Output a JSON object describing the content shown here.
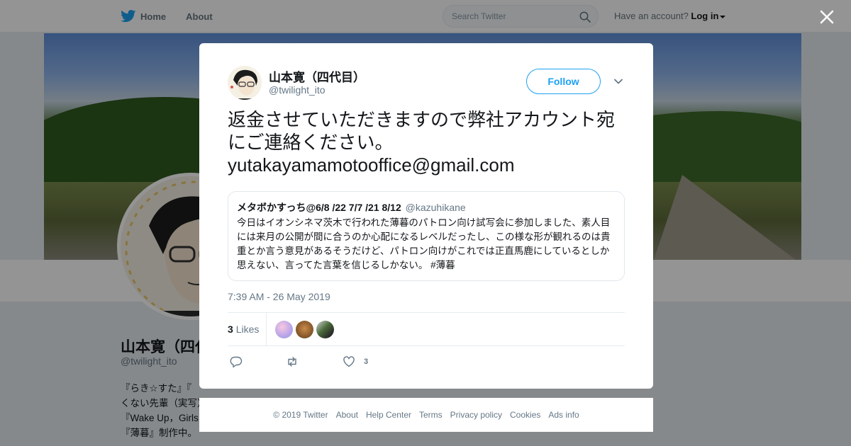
{
  "nav": {
    "home_label": "Home",
    "about_label": "About",
    "search_placeholder": "Search Twitter",
    "account_prompt": "Have an account?",
    "login_label": "Log in"
  },
  "profile": {
    "name": "山本寛（四代目）",
    "handle": "@twilight_ito",
    "bio_lines": [
      "『らき☆すた』『",
      "くない先輩（実写）『フラクタル",
      "『Wake Up，Girls",
      "『薄暮』制作中。"
    ]
  },
  "tweet": {
    "author_name": "山本寛（四代目）",
    "author_handle": "@twilight_ito",
    "follow_label": "Follow",
    "text": "返金させていただきますので弊社アカウント宛にご連絡ください。\nyutakayamamotooffice@gmail.com",
    "quoted": {
      "author_name": "メタボかすっち@6/8 /22 7/7 /21 8/12",
      "author_handle": "@kazuhikane",
      "text": "今日はイオンシネマ茨木で行われた薄暮のパトロン向け試写会に参加しました、素人目には来月の公開が間に合うのか心配になるレベルだったし、この様な形が観れるのは貴重とか言う意見があるそうだけど、パトロン向けがこれでは正直馬鹿にしているとしか思えない、言ってた言葉を信じるしかない。 #薄暮"
    },
    "timestamp": "7:39 AM - 26 May 2019",
    "likes_count": "3",
    "likes_label": "Likes",
    "like_action_count": "3"
  },
  "footer": {
    "links": [
      "© 2019 Twitter",
      "About",
      "Help Center",
      "Terms",
      "Privacy policy",
      "Cookies",
      "Ads info"
    ]
  },
  "colors": {
    "accent": "#1da1f2",
    "secondary_text": "#657786"
  },
  "icons": [
    "twitter-bird-icon",
    "search-icon",
    "close-icon",
    "chevron-down-icon",
    "reply-icon",
    "retweet-icon",
    "heart-icon"
  ]
}
